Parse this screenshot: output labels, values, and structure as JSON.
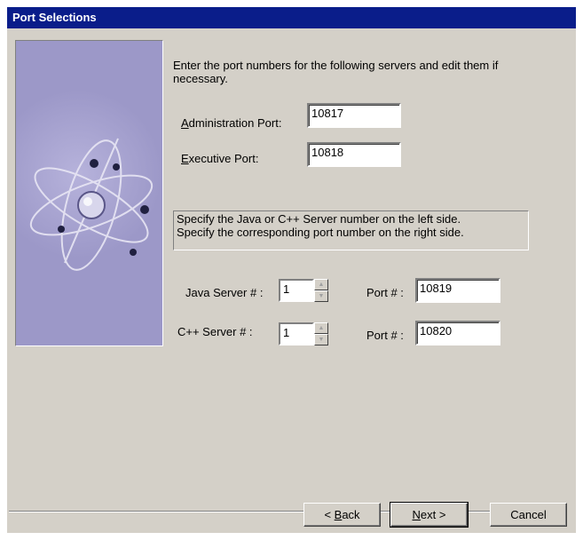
{
  "window": {
    "title": "Port Selections"
  },
  "intro_text": "Enter the port numbers for the following servers and edit them if necessary.",
  "admin_port": {
    "label_mnemonic": "A",
    "label_rest": "dministration Port:",
    "value": "10817"
  },
  "exec_port": {
    "label_mnemonic": "E",
    "label_rest": "xecutive Port:",
    "value": "10818"
  },
  "info": {
    "line1": "Specify the Java or C++ Server number on the left side.",
    "line2": "Specify the corresponding port number on the right side."
  },
  "java_server": {
    "label": "Java Server # :",
    "server_value": "1",
    "port_label": "Port # :",
    "port_value": "10819"
  },
  "cpp_server": {
    "label": "C++ Server # :",
    "server_value": "1",
    "port_label": "Port # :",
    "port_value": "10820"
  },
  "buttons": {
    "back_prefix": "< ",
    "back_mnemonic": "B",
    "back_rest": "ack",
    "next_mnemonic": "N",
    "next_rest": "ext >",
    "cancel": "Cancel"
  },
  "colors": {
    "titlebar": "#0a1d8a",
    "dialog_bg": "#d4d0c8",
    "image_bg": "#9c98c8"
  },
  "icons": {
    "side_image": "atom-graphic"
  }
}
